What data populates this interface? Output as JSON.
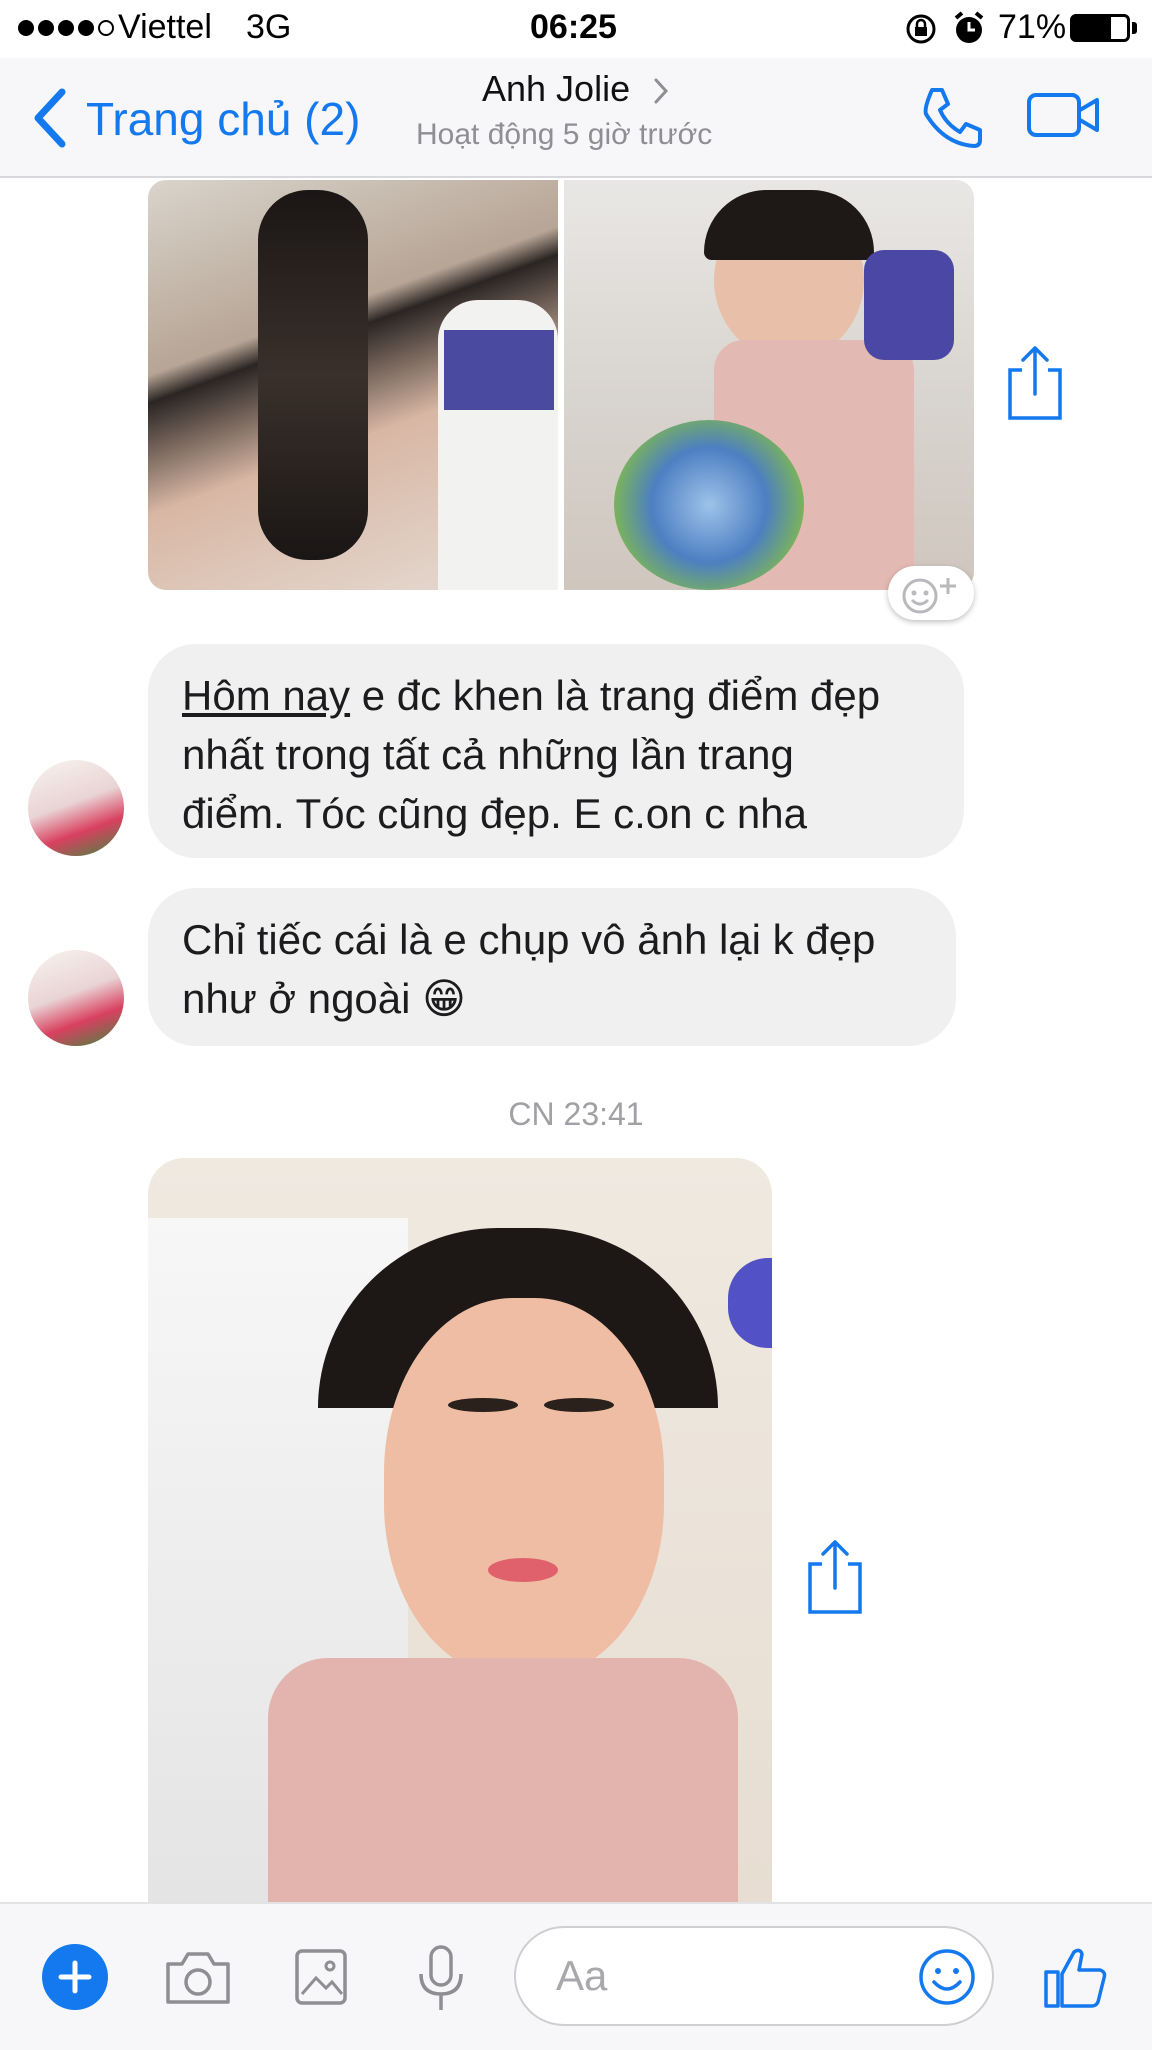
{
  "status_bar": {
    "carrier": "Viettel",
    "network": "3G",
    "time": "06:25",
    "battery": "71%",
    "battery_level": 0.71
  },
  "nav": {
    "back_label": "Trang chủ (2)",
    "contact_name": "Anh Jolie",
    "status": "Hoạt động 5 giờ trước",
    "icons": [
      "chevron-left-icon",
      "chevron-right-icon",
      "phone-icon",
      "video-camera-icon"
    ]
  },
  "messages": {
    "bubble1": {
      "underlined": "Hôm nay",
      "line1_rest": " e đc khen là trang điểm đẹp",
      "line2": "nhất trong tất cả những lần trang",
      "line3": "điểm. Tóc cũng đẹp.  E c.on c nha"
    },
    "bubble2": {
      "line1": "Chỉ tiếc cái là e chụp vô ảnh lại k đẹp",
      "line2": "như ở ngoài",
      "emoji": "😁"
    },
    "timestamp": "CN 23:41"
  },
  "composer": {
    "placeholder": "Aa",
    "icons": [
      "plus-icon",
      "camera-icon",
      "image-icon",
      "microphone-icon",
      "emoji-icon",
      "thumbs-up-icon"
    ]
  },
  "colors": {
    "accent": "#1479ee",
    "bubble": "#f1f0f0",
    "nav_bg": "#f7f7f9"
  }
}
